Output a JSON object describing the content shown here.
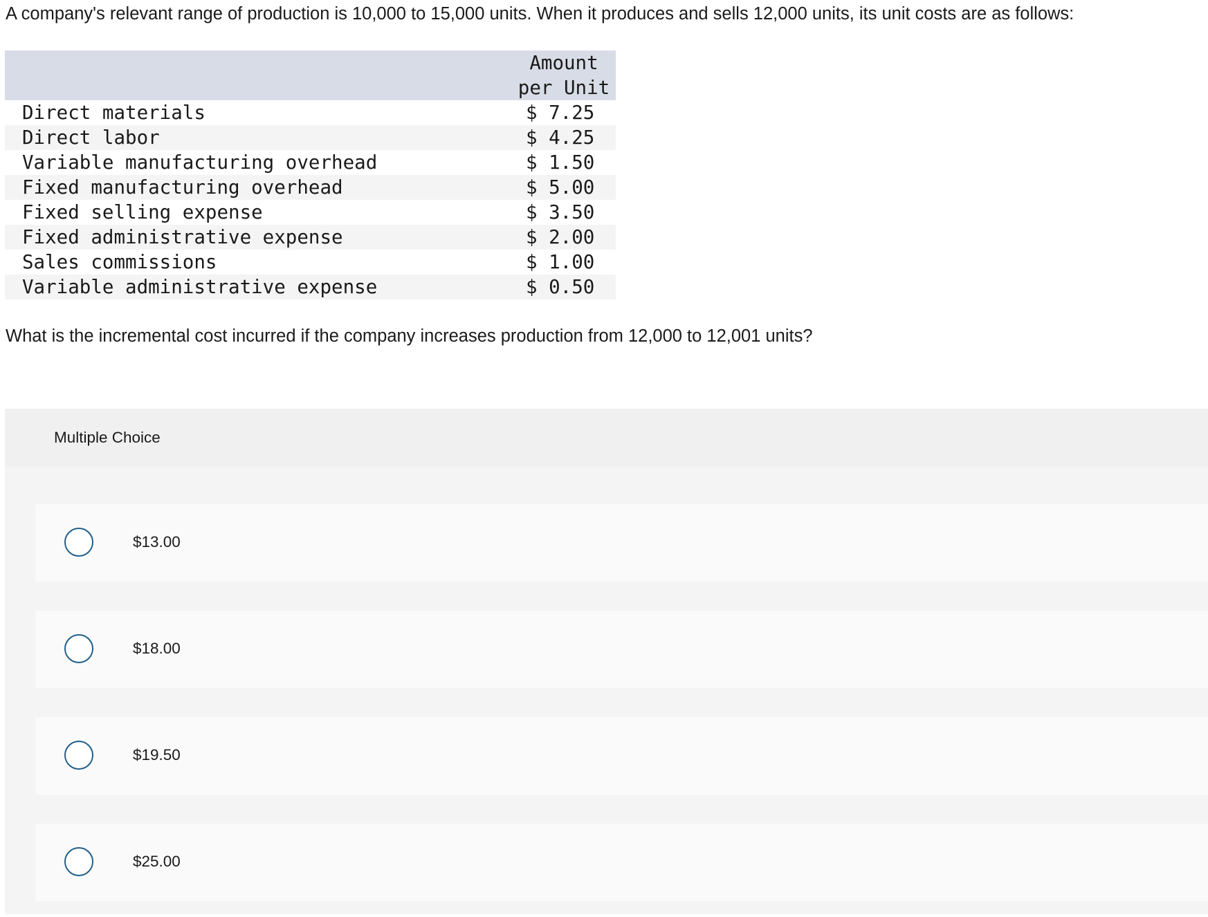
{
  "intro_text": "A company's relevant range of production is 10,000 to 15,000 units. When it produces and sells 12,000 units, its unit costs are as follows:",
  "table": {
    "header_line1": "Amount",
    "header_line2": "per Unit",
    "rows": [
      {
        "label": "Direct materials",
        "amount": "$ 7.25"
      },
      {
        "label": "Direct labor",
        "amount": "$ 4.25"
      },
      {
        "label": "Variable manufacturing overhead",
        "amount": "$ 1.50"
      },
      {
        "label": "Fixed manufacturing overhead",
        "amount": "$ 5.00"
      },
      {
        "label": "Fixed selling expense",
        "amount": "$ 3.50"
      },
      {
        "label": "Fixed administrative expense",
        "amount": "$ 2.00"
      },
      {
        "label": "Sales commissions",
        "amount": "$ 1.00"
      },
      {
        "label": "Variable administrative expense",
        "amount": "$ 0.50"
      }
    ]
  },
  "question_text": "What is the incremental cost incurred if the company increases production from 12,000 to 12,001 units?",
  "multiple_choice": {
    "title": "Multiple Choice",
    "options": [
      {
        "label": "$13.00",
        "selected": false
      },
      {
        "label": "$18.00",
        "selected": false
      },
      {
        "label": "$19.50",
        "selected": false
      },
      {
        "label": "$25.00",
        "selected": false
      }
    ]
  },
  "colors": {
    "table_header_bg": "#d8dce6",
    "radio_border": "#1f5e8a",
    "panel_bg": "#f4f4f4"
  }
}
